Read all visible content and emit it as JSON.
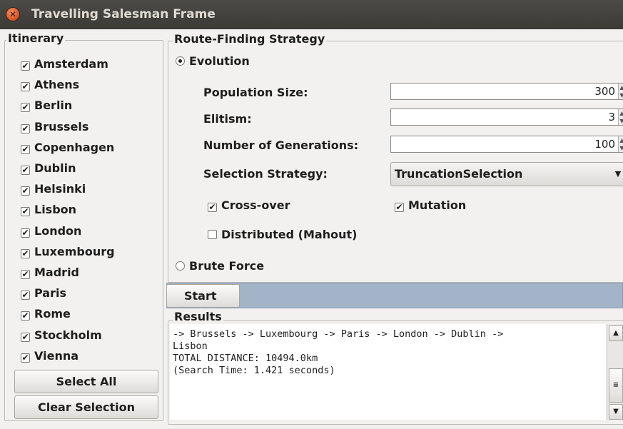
{
  "window": {
    "title": "Travelling Salesman Frame",
    "close_icon": "close-icon"
  },
  "itinerary": {
    "title": "Itinerary",
    "cities": [
      {
        "name": "Amsterdam",
        "checked": true
      },
      {
        "name": "Athens",
        "checked": true
      },
      {
        "name": "Berlin",
        "checked": true
      },
      {
        "name": "Brussels",
        "checked": true
      },
      {
        "name": "Copenhagen",
        "checked": true
      },
      {
        "name": "Dublin",
        "checked": true
      },
      {
        "name": "Helsinki",
        "checked": true
      },
      {
        "name": "Lisbon",
        "checked": true
      },
      {
        "name": "London",
        "checked": true
      },
      {
        "name": "Luxembourg",
        "checked": true
      },
      {
        "name": "Madrid",
        "checked": true
      },
      {
        "name": "Paris",
        "checked": true
      },
      {
        "name": "Rome",
        "checked": true
      },
      {
        "name": "Stockholm",
        "checked": true
      },
      {
        "name": "Vienna",
        "checked": true
      }
    ],
    "select_all": "Select All",
    "clear_selection": "Clear Selection"
  },
  "strategy": {
    "title": "Route-Finding Strategy",
    "evolution_label": "Evolution",
    "evolution_selected": true,
    "population_label": "Population Size:",
    "population_value": "300",
    "elitism_label": "Elitism:",
    "elitism_value": "3",
    "generations_label": "Number of Generations:",
    "generations_value": "100",
    "selection_label": "Selection Strategy:",
    "selection_value": "TruncationSelection",
    "crossover_label": "Cross-over",
    "crossover_checked": true,
    "mutation_label": "Mutation",
    "mutation_checked": true,
    "distributed_label": "Distributed (Mahout)",
    "distributed_checked": false,
    "brute_force_label": "Brute Force",
    "brute_force_selected": false
  },
  "start_button": "Start",
  "results": {
    "title": "Results",
    "lines": [
      "-> Brussels -> Luxembourg -> Paris -> London -> Dublin ->",
      "Lisbon",
      "TOTAL DISTANCE: 10494.0km",
      "(Search Time: 1.421 seconds)"
    ]
  }
}
